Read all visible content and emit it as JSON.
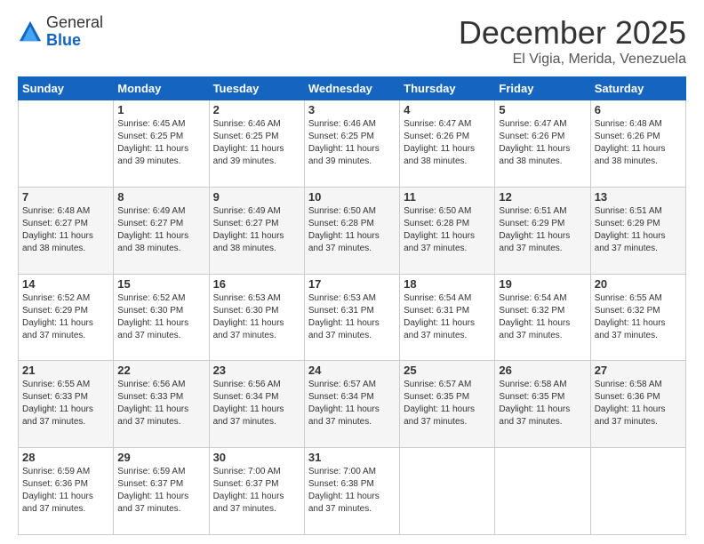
{
  "logo": {
    "general": "General",
    "blue": "Blue"
  },
  "header": {
    "month": "December 2025",
    "location": "El Vigia, Merida, Venezuela"
  },
  "days_of_week": [
    "Sunday",
    "Monday",
    "Tuesday",
    "Wednesday",
    "Thursday",
    "Friday",
    "Saturday"
  ],
  "weeks": [
    [
      {
        "day": "",
        "sunrise": "",
        "sunset": "",
        "daylight": ""
      },
      {
        "day": "1",
        "sunrise": "Sunrise: 6:45 AM",
        "sunset": "Sunset: 6:25 PM",
        "daylight": "Daylight: 11 hours and 39 minutes."
      },
      {
        "day": "2",
        "sunrise": "Sunrise: 6:46 AM",
        "sunset": "Sunset: 6:25 PM",
        "daylight": "Daylight: 11 hours and 39 minutes."
      },
      {
        "day": "3",
        "sunrise": "Sunrise: 6:46 AM",
        "sunset": "Sunset: 6:25 PM",
        "daylight": "Daylight: 11 hours and 39 minutes."
      },
      {
        "day": "4",
        "sunrise": "Sunrise: 6:47 AM",
        "sunset": "Sunset: 6:26 PM",
        "daylight": "Daylight: 11 hours and 38 minutes."
      },
      {
        "day": "5",
        "sunrise": "Sunrise: 6:47 AM",
        "sunset": "Sunset: 6:26 PM",
        "daylight": "Daylight: 11 hours and 38 minutes."
      },
      {
        "day": "6",
        "sunrise": "Sunrise: 6:48 AM",
        "sunset": "Sunset: 6:26 PM",
        "daylight": "Daylight: 11 hours and 38 minutes."
      }
    ],
    [
      {
        "day": "7",
        "sunrise": "Sunrise: 6:48 AM",
        "sunset": "Sunset: 6:27 PM",
        "daylight": "Daylight: 11 hours and 38 minutes."
      },
      {
        "day": "8",
        "sunrise": "Sunrise: 6:49 AM",
        "sunset": "Sunset: 6:27 PM",
        "daylight": "Daylight: 11 hours and 38 minutes."
      },
      {
        "day": "9",
        "sunrise": "Sunrise: 6:49 AM",
        "sunset": "Sunset: 6:27 PM",
        "daylight": "Daylight: 11 hours and 38 minutes."
      },
      {
        "day": "10",
        "sunrise": "Sunrise: 6:50 AM",
        "sunset": "Sunset: 6:28 PM",
        "daylight": "Daylight: 11 hours and 37 minutes."
      },
      {
        "day": "11",
        "sunrise": "Sunrise: 6:50 AM",
        "sunset": "Sunset: 6:28 PM",
        "daylight": "Daylight: 11 hours and 37 minutes."
      },
      {
        "day": "12",
        "sunrise": "Sunrise: 6:51 AM",
        "sunset": "Sunset: 6:29 PM",
        "daylight": "Daylight: 11 hours and 37 minutes."
      },
      {
        "day": "13",
        "sunrise": "Sunrise: 6:51 AM",
        "sunset": "Sunset: 6:29 PM",
        "daylight": "Daylight: 11 hours and 37 minutes."
      }
    ],
    [
      {
        "day": "14",
        "sunrise": "Sunrise: 6:52 AM",
        "sunset": "Sunset: 6:29 PM",
        "daylight": "Daylight: 11 hours and 37 minutes."
      },
      {
        "day": "15",
        "sunrise": "Sunrise: 6:52 AM",
        "sunset": "Sunset: 6:30 PM",
        "daylight": "Daylight: 11 hours and 37 minutes."
      },
      {
        "day": "16",
        "sunrise": "Sunrise: 6:53 AM",
        "sunset": "Sunset: 6:30 PM",
        "daylight": "Daylight: 11 hours and 37 minutes."
      },
      {
        "day": "17",
        "sunrise": "Sunrise: 6:53 AM",
        "sunset": "Sunset: 6:31 PM",
        "daylight": "Daylight: 11 hours and 37 minutes."
      },
      {
        "day": "18",
        "sunrise": "Sunrise: 6:54 AM",
        "sunset": "Sunset: 6:31 PM",
        "daylight": "Daylight: 11 hours and 37 minutes."
      },
      {
        "day": "19",
        "sunrise": "Sunrise: 6:54 AM",
        "sunset": "Sunset: 6:32 PM",
        "daylight": "Daylight: 11 hours and 37 minutes."
      },
      {
        "day": "20",
        "sunrise": "Sunrise: 6:55 AM",
        "sunset": "Sunset: 6:32 PM",
        "daylight": "Daylight: 11 hours and 37 minutes."
      }
    ],
    [
      {
        "day": "21",
        "sunrise": "Sunrise: 6:55 AM",
        "sunset": "Sunset: 6:33 PM",
        "daylight": "Daylight: 11 hours and 37 minutes."
      },
      {
        "day": "22",
        "sunrise": "Sunrise: 6:56 AM",
        "sunset": "Sunset: 6:33 PM",
        "daylight": "Daylight: 11 hours and 37 minutes."
      },
      {
        "day": "23",
        "sunrise": "Sunrise: 6:56 AM",
        "sunset": "Sunset: 6:34 PM",
        "daylight": "Daylight: 11 hours and 37 minutes."
      },
      {
        "day": "24",
        "sunrise": "Sunrise: 6:57 AM",
        "sunset": "Sunset: 6:34 PM",
        "daylight": "Daylight: 11 hours and 37 minutes."
      },
      {
        "day": "25",
        "sunrise": "Sunrise: 6:57 AM",
        "sunset": "Sunset: 6:35 PM",
        "daylight": "Daylight: 11 hours and 37 minutes."
      },
      {
        "day": "26",
        "sunrise": "Sunrise: 6:58 AM",
        "sunset": "Sunset: 6:35 PM",
        "daylight": "Daylight: 11 hours and 37 minutes."
      },
      {
        "day": "27",
        "sunrise": "Sunrise: 6:58 AM",
        "sunset": "Sunset: 6:36 PM",
        "daylight": "Daylight: 11 hours and 37 minutes."
      }
    ],
    [
      {
        "day": "28",
        "sunrise": "Sunrise: 6:59 AM",
        "sunset": "Sunset: 6:36 PM",
        "daylight": "Daylight: 11 hours and 37 minutes."
      },
      {
        "day": "29",
        "sunrise": "Sunrise: 6:59 AM",
        "sunset": "Sunset: 6:37 PM",
        "daylight": "Daylight: 11 hours and 37 minutes."
      },
      {
        "day": "30",
        "sunrise": "Sunrise: 7:00 AM",
        "sunset": "Sunset: 6:37 PM",
        "daylight": "Daylight: 11 hours and 37 minutes."
      },
      {
        "day": "31",
        "sunrise": "Sunrise: 7:00 AM",
        "sunset": "Sunset: 6:38 PM",
        "daylight": "Daylight: 11 hours and 37 minutes."
      },
      {
        "day": "",
        "sunrise": "",
        "sunset": "",
        "daylight": ""
      },
      {
        "day": "",
        "sunrise": "",
        "sunset": "",
        "daylight": ""
      },
      {
        "day": "",
        "sunrise": "",
        "sunset": "",
        "daylight": ""
      }
    ]
  ]
}
